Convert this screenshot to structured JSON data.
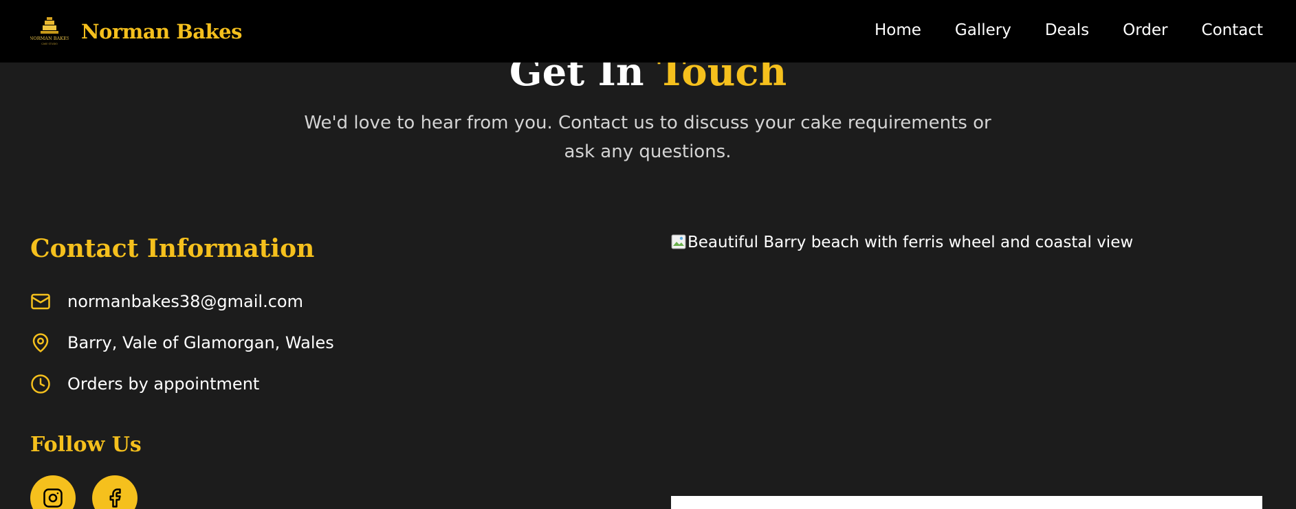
{
  "brand": {
    "name": "Norman Bakes",
    "logo_text": "NORMAN BAKES",
    "logo_tagline": "CAKE STUDIO"
  },
  "nav": {
    "items": [
      {
        "label": "Home"
      },
      {
        "label": "Gallery"
      },
      {
        "label": "Deals"
      },
      {
        "label": "Order"
      },
      {
        "label": "Contact"
      }
    ]
  },
  "hero": {
    "title_part1": "Get In ",
    "title_accent": "Touch",
    "subtitle_line1": "We'd love to hear from you. Contact us to discuss your cake requirements or",
    "subtitle_line2": "ask any questions."
  },
  "contact": {
    "title": "Contact Information",
    "items": [
      {
        "icon": "mail-icon",
        "text": "normanbakes38@gmail.com"
      },
      {
        "icon": "map-pin-icon",
        "text": "Barry, Vale of Glamorgan, Wales"
      },
      {
        "icon": "clock-icon",
        "text": "Orders by appointment"
      }
    ]
  },
  "follow": {
    "title": "Follow Us",
    "socials": [
      {
        "icon": "instagram-icon"
      },
      {
        "icon": "facebook-icon"
      }
    ]
  },
  "image": {
    "alt": "Beautiful Barry beach with ferris wheel and coastal view"
  },
  "colors": {
    "accent": "#f5c01d",
    "nav_bg": "#000000",
    "page_bg": "#1c1c1c",
    "text": "#ffffff",
    "muted_text": "#d4d4d4"
  }
}
